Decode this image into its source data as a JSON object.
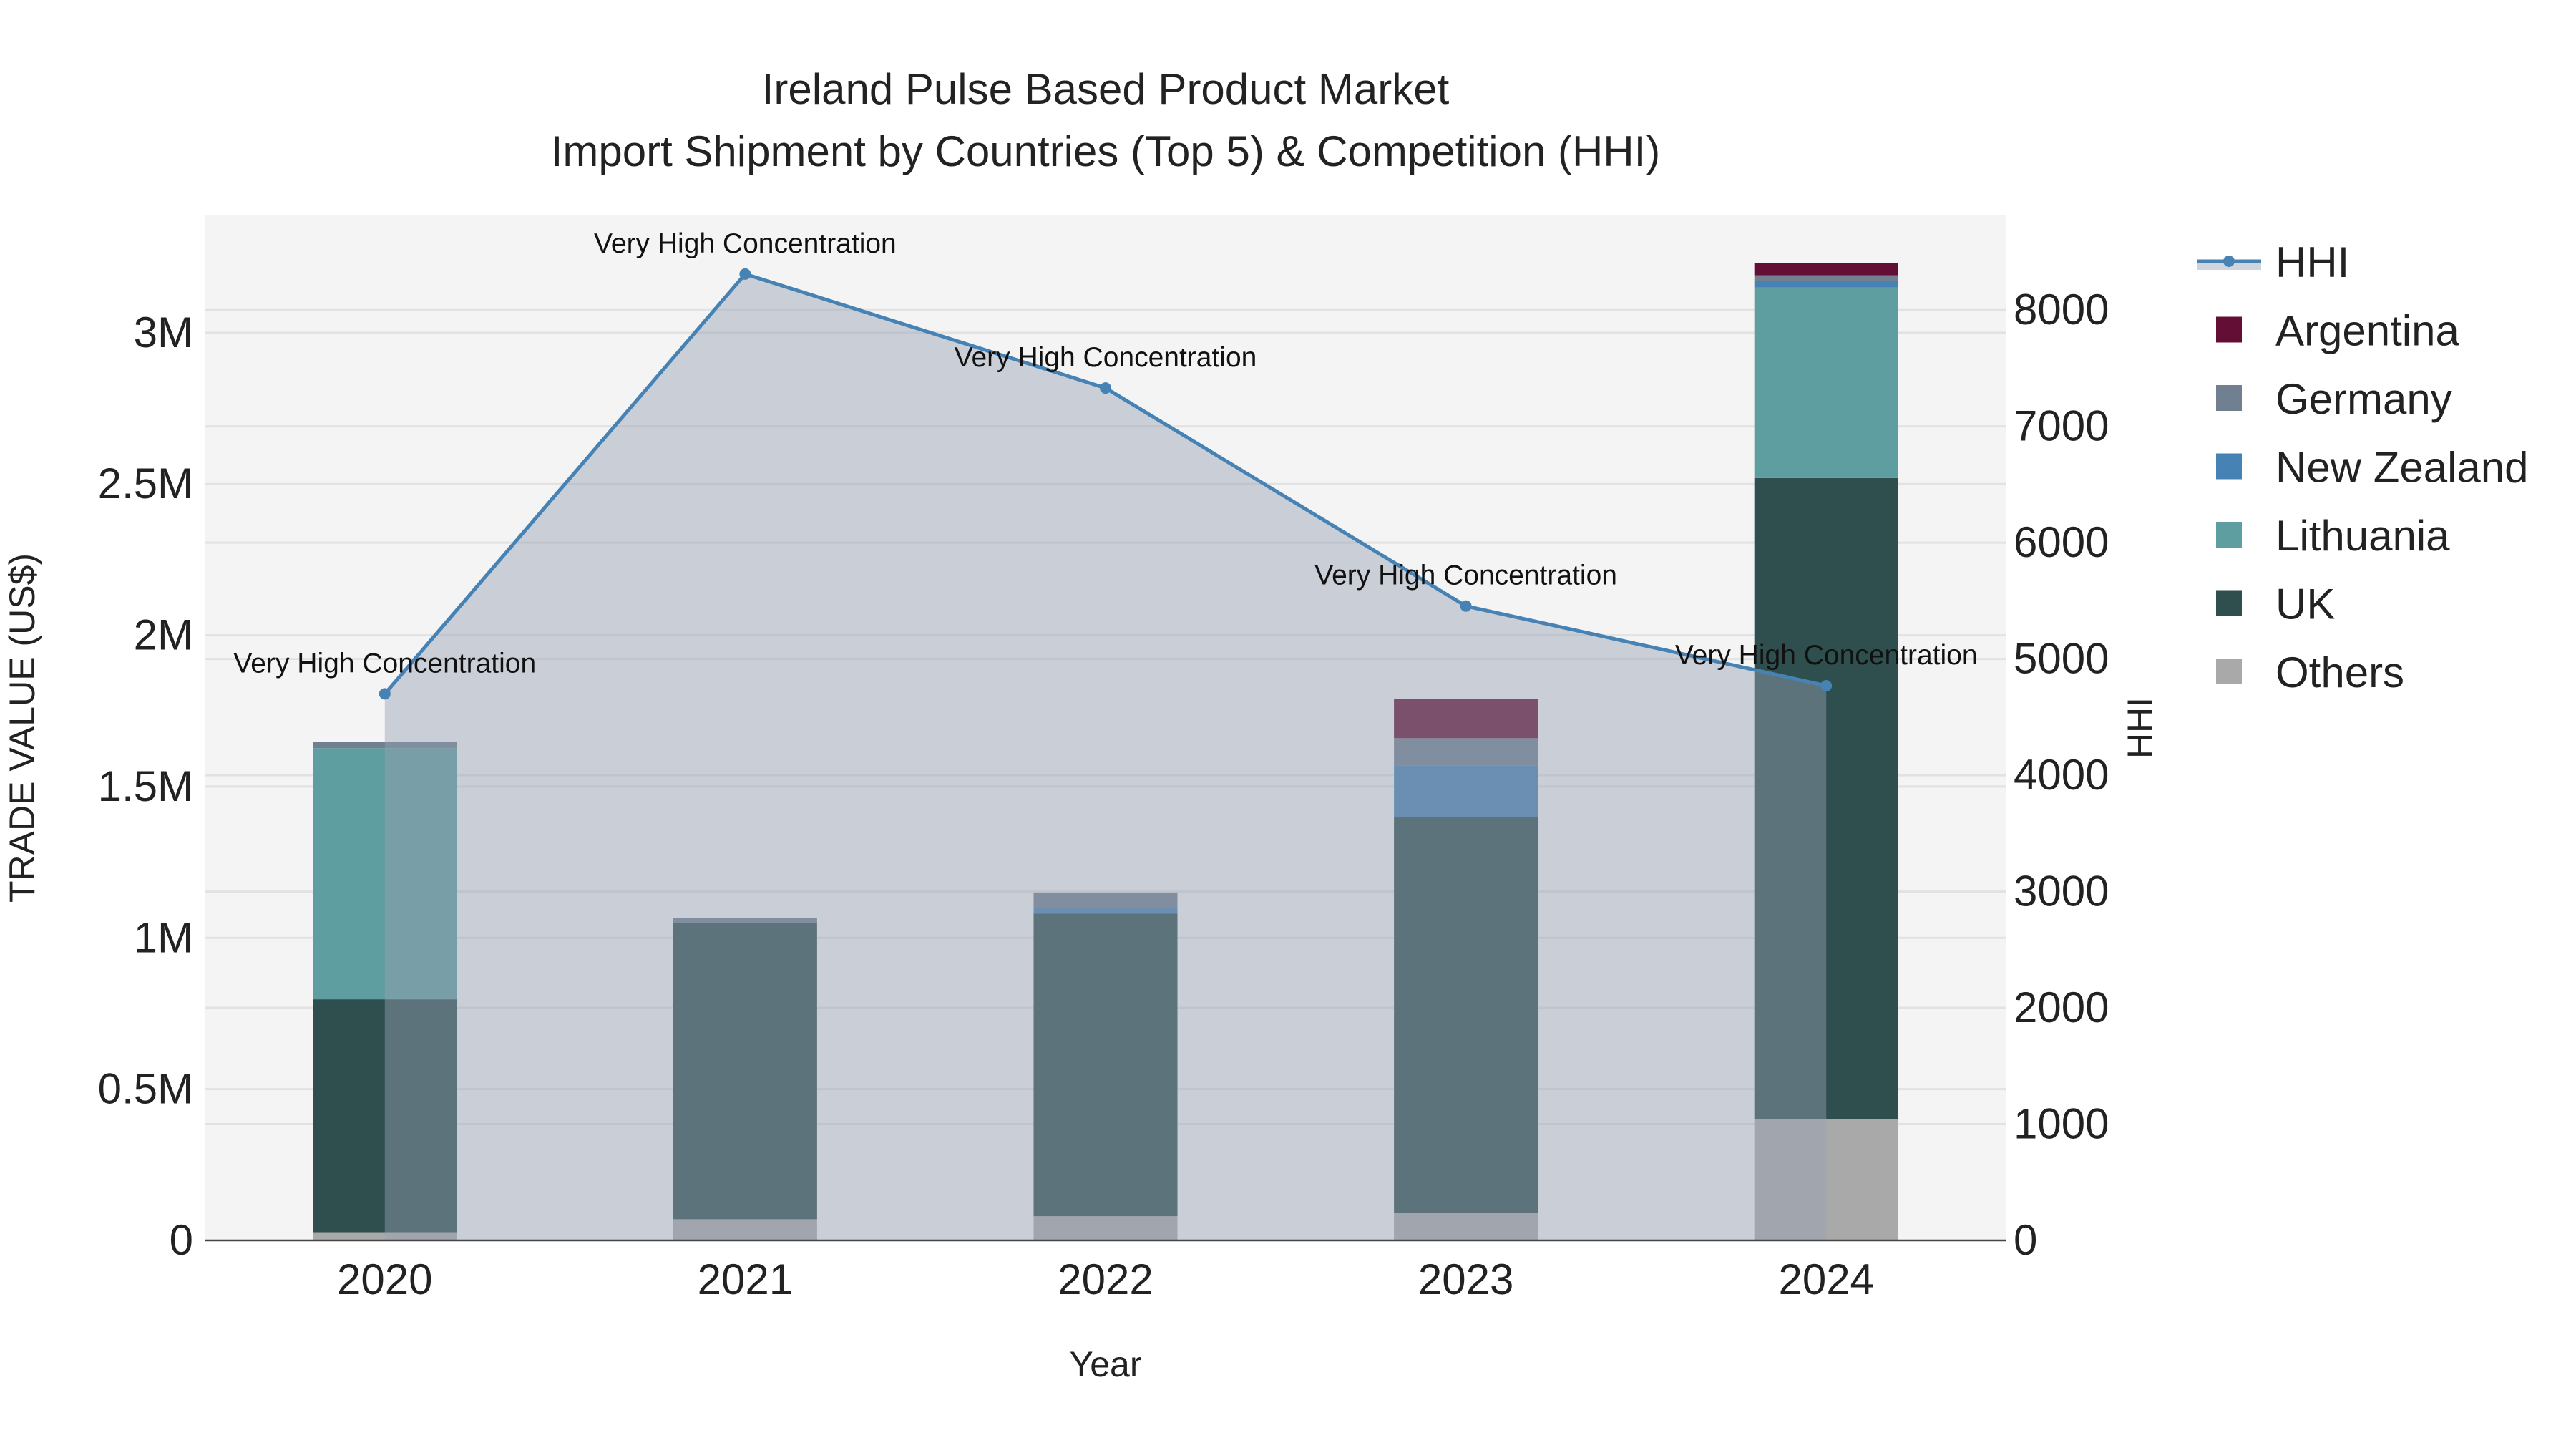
{
  "chart_data": {
    "type": "bar",
    "title": "Ireland Pulse Based Product Market",
    "subtitle": "Import Shipment by Countries (Top 5) & Competition (HHI)",
    "xlabel": "Year",
    "ylabel": "TRADE VALUE (US$)",
    "y2label": "HHI",
    "categories": [
      "2020",
      "2021",
      "2022",
      "2023",
      "2024"
    ],
    "ylim": [
      0,
      3390000
    ],
    "y2lim": [
      0,
      8820
    ],
    "yticks": [
      0,
      500000,
      1000000,
      1500000,
      2000000,
      2500000,
      3000000
    ],
    "ytick_labels": [
      "0",
      "0.5M",
      "1M",
      "1.5M",
      "2M",
      "2.5M",
      "3M"
    ],
    "y2ticks": [
      0,
      1000,
      2000,
      3000,
      4000,
      5000,
      6000,
      7000,
      8000
    ],
    "y2tick_labels": [
      "0",
      "1000",
      "2000",
      "3000",
      "4000",
      "5000",
      "6000",
      "7000",
      "8000"
    ],
    "series": [
      {
        "name": "Others",
        "color": "#a9a9a9",
        "values": [
          27000,
          70000,
          80000,
          90000,
          400000
        ]
      },
      {
        "name": "UK",
        "color": "#2f4f4f",
        "values": [
          770000,
          980000,
          1000000,
          1310000,
          2120000
        ]
      },
      {
        "name": "Lithuania",
        "color": "#5f9ea0",
        "values": [
          830000,
          0,
          0,
          0,
          630000
        ]
      },
      {
        "name": "New Zealand",
        "color": "#4682b4",
        "values": [
          0,
          0,
          20000,
          170000,
          20000
        ]
      },
      {
        "name": "Germany",
        "color": "#708090",
        "values": [
          20000,
          15000,
          50000,
          90000,
          20000
        ]
      },
      {
        "name": "Argentina",
        "color": "#630f35",
        "values": [
          0,
          0,
          0,
          130000,
          40000
        ]
      }
    ],
    "line": {
      "name": "HHI",
      "color": "#4682b4",
      "fill": "rgba(150,160,178,0.45)",
      "values": [
        4700,
        8310,
        7330,
        5455,
        4770
      ],
      "annotations": [
        "Very High Concentration",
        "Very High Concentration",
        "Very High Concentration",
        "Very High Concentration",
        "Very High Concentration"
      ]
    },
    "legend_order": [
      "HHI",
      "Argentina",
      "Germany",
      "New Zealand",
      "Lithuania",
      "UK",
      "Others"
    ],
    "legend_position": "right",
    "grid": true
  }
}
